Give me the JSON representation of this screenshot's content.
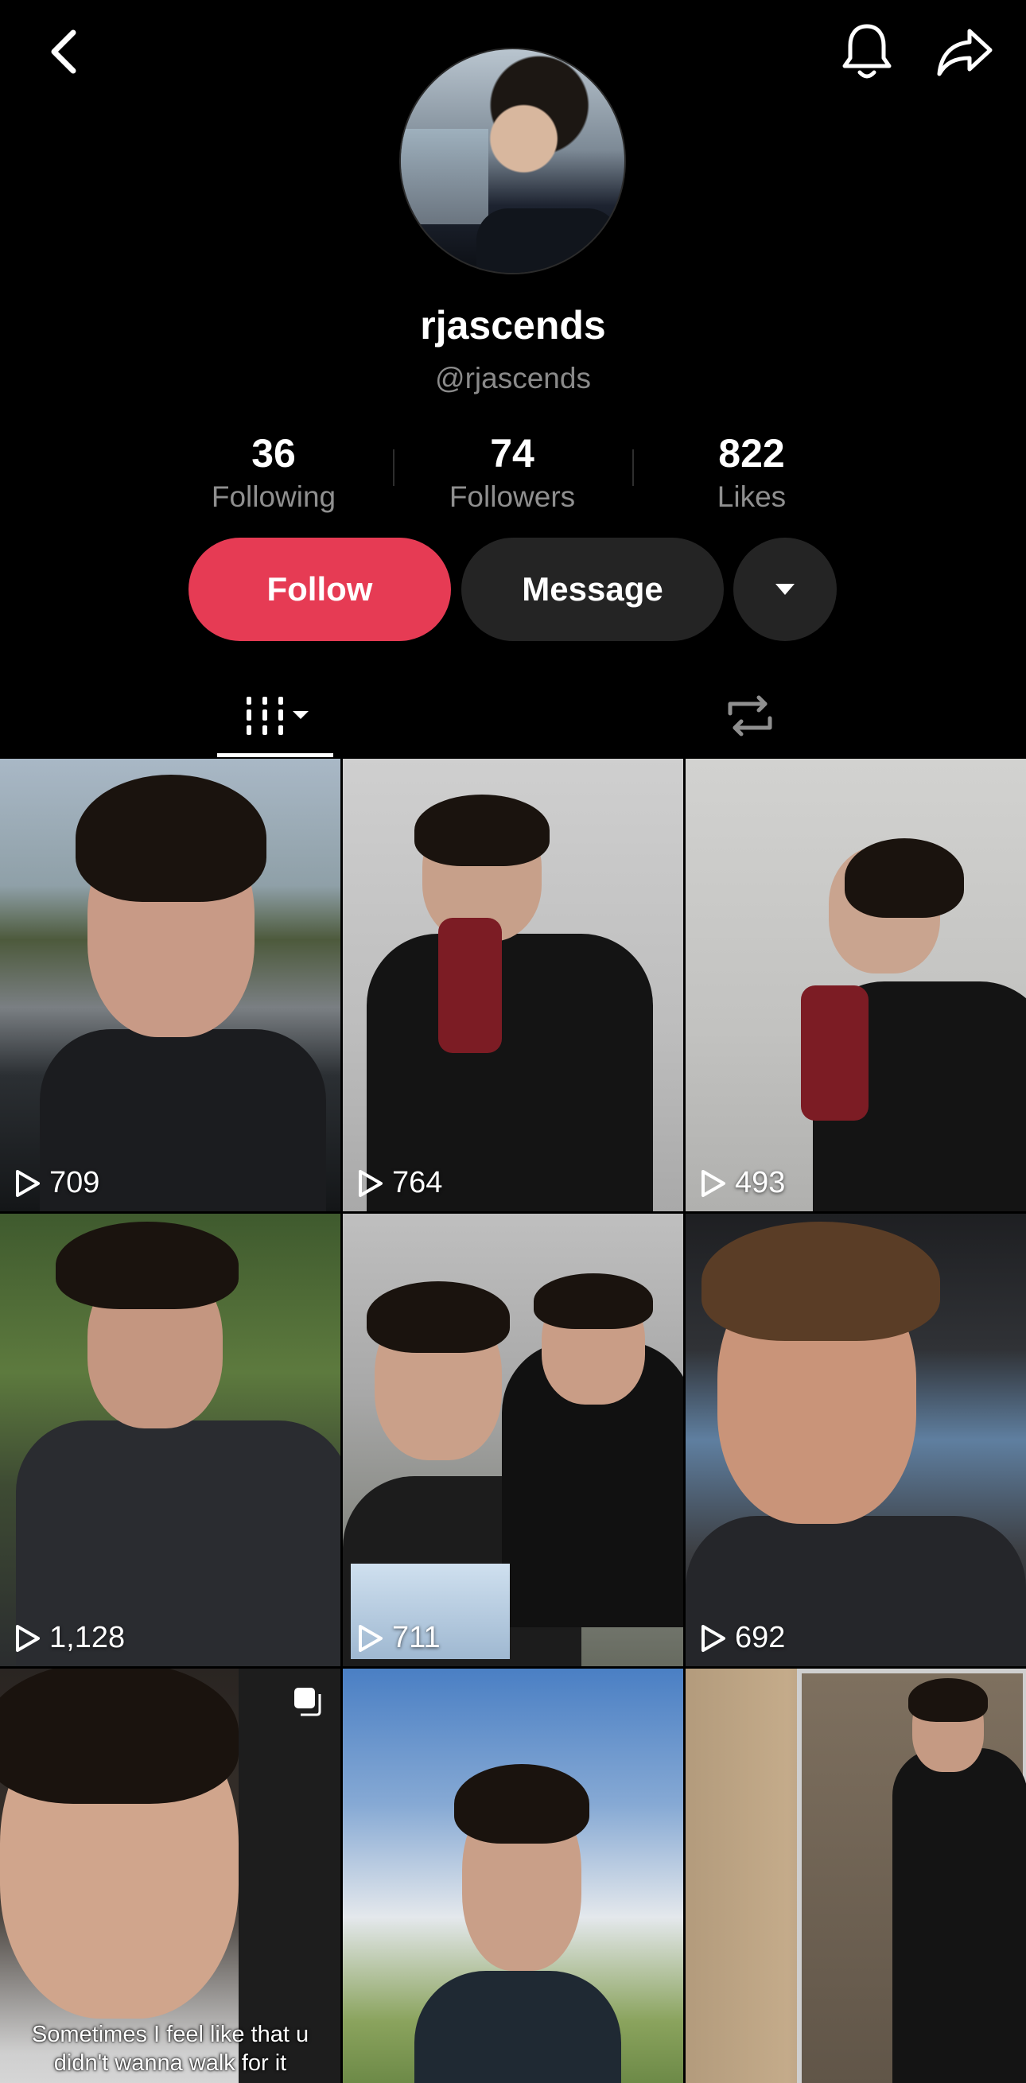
{
  "profile": {
    "display_name": "rjascends",
    "handle": "@rjascends"
  },
  "stats": {
    "following": {
      "value": "36",
      "label": "Following"
    },
    "followers": {
      "value": "74",
      "label": "Followers"
    },
    "likes": {
      "value": "822",
      "label": "Likes"
    }
  },
  "actions": {
    "follow_label": "Follow",
    "message_label": "Message"
  },
  "colors": {
    "follow_accent": "#e63b54",
    "secondary_button": "#242424",
    "background": "#000000"
  },
  "icons": {
    "back": "chevron-left-icon",
    "notifications": "bell-icon",
    "share": "share-icon",
    "more": "caret-down-icon",
    "videos_tab": "grid-icon",
    "reposts_tab": "repost-icon",
    "play": "play-icon"
  },
  "videos": [
    {
      "views": "709"
    },
    {
      "views": "764"
    },
    {
      "views": "493"
    },
    {
      "views": "1,128"
    },
    {
      "views": "711"
    },
    {
      "views": "692"
    },
    {
      "views": "",
      "caption": "Sometimes I feel like that u didn't wanna walk for it"
    },
    {
      "views": ""
    },
    {
      "views": ""
    }
  ]
}
